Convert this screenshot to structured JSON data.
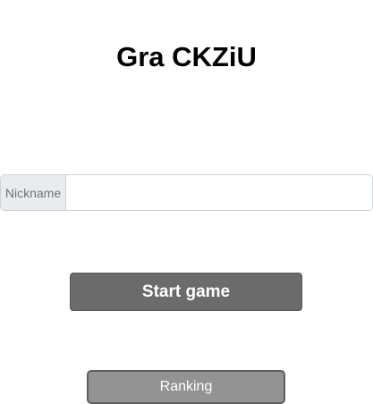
{
  "header": {
    "title": "Gra CKZiU"
  },
  "form": {
    "nickname_label": "Nickname",
    "nickname_value": "",
    "nickname_placeholder": ""
  },
  "actions": {
    "start_label": "Start game",
    "ranking_label": "Ranking"
  },
  "colors": {
    "start_button": "#6b6b6b",
    "ranking_button": "#939393",
    "addon_background": "#e9ecef"
  }
}
